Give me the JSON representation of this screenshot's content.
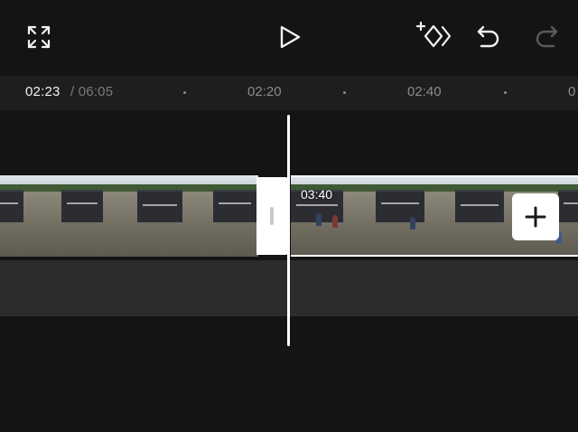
{
  "toolbar": {
    "fullscreen_icon": "fullscreen-icon",
    "play_icon": "play-icon",
    "keyframe_icon": "add-keyframe-icon",
    "undo_icon": "undo-icon",
    "redo_icon": "redo-icon"
  },
  "timecode": {
    "current": "02:23",
    "total": "/ 06:05"
  },
  "ruler": {
    "ticks": [
      "02:20",
      "02:40",
      "0"
    ]
  },
  "timeline": {
    "clip_duration": "03:40",
    "add_clip_icon": "plus-icon"
  },
  "colors": {
    "background": "#141414",
    "ruler_background": "#1e1e1e",
    "audio_track": "#2c2c2c",
    "accent": "#ffffff",
    "muted_text": "#8a8a8a"
  }
}
